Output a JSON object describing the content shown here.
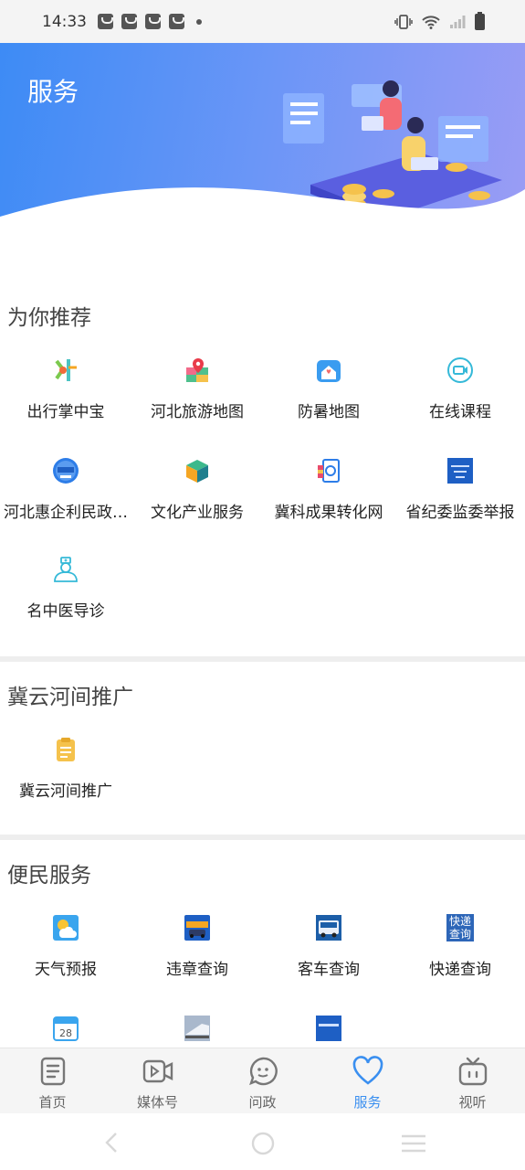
{
  "status_bar": {
    "time": "14:33"
  },
  "header": {
    "title": "服务"
  },
  "sections": {
    "recommend": {
      "title": "为你推荐",
      "items": [
        {
          "label": "出行掌中宝",
          "icon": "transit-map-icon"
        },
        {
          "label": "河北旅游地图",
          "icon": "travel-map-icon"
        },
        {
          "label": "防暑地图",
          "icon": "heat-map-icon"
        },
        {
          "label": "在线课程",
          "icon": "online-course-icon"
        },
        {
          "label": "河北惠企利民政…",
          "icon": "policy-badge-icon"
        },
        {
          "label": "文化产业服务",
          "icon": "culture-box-icon"
        },
        {
          "label": "冀科成果转化网",
          "icon": "science-doc-icon"
        },
        {
          "label": "省纪委监委举报",
          "icon": "report-banner-icon"
        },
        {
          "label": "名中医导诊",
          "icon": "doctor-icon"
        }
      ]
    },
    "promo": {
      "title": "冀云河间推广",
      "items": [
        {
          "label": "冀云河间推广",
          "icon": "clipboard-icon"
        }
      ]
    },
    "convenience": {
      "title": "便民服务",
      "items": [
        {
          "label": "天气预报",
          "icon": "weather-icon"
        },
        {
          "label": "违章查询",
          "icon": "traffic-violation-icon"
        },
        {
          "label": "客车查询",
          "icon": "bus-icon"
        },
        {
          "label": "快递查询",
          "icon": "express-icon",
          "icon_text": "快递查询"
        }
      ]
    }
  },
  "tabbar": [
    {
      "label": "首页",
      "icon": "home-doc-icon",
      "active": false
    },
    {
      "label": "媒体号",
      "icon": "video-icon",
      "active": false
    },
    {
      "label": "问政",
      "icon": "chat-bubble-icon",
      "active": false
    },
    {
      "label": "服务",
      "icon": "heart-icon",
      "active": true
    },
    {
      "label": "视听",
      "icon": "tv-icon",
      "active": false
    }
  ],
  "colors": {
    "accent": "#3a8ff0",
    "banner_start": "#3d8bf5",
    "banner_end": "#9a9cf5"
  }
}
